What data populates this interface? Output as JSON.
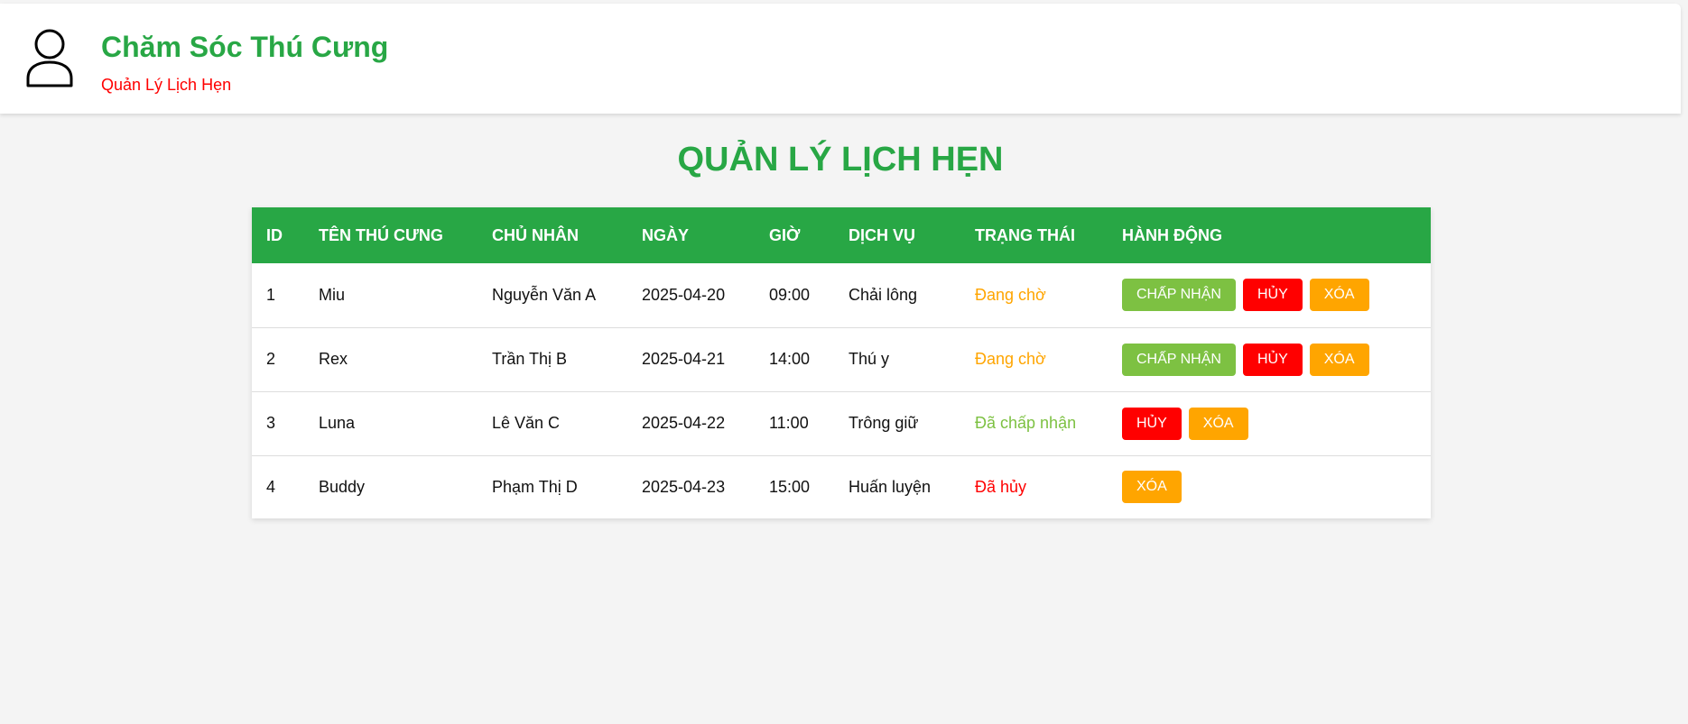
{
  "header": {
    "logo_icon": "user-icon",
    "title": "Chăm Sóc Thú Cưng",
    "subtitle": "Quản Lý Lịch Hẹn"
  },
  "page": {
    "title": "QUẢN LÝ LỊCH HẸN"
  },
  "colors": {
    "brand_green": "#28a745",
    "subtitle_red": "#ff0000",
    "accept_green": "#7dc142",
    "cancel_red": "#ff0000",
    "delete_orange": "#ffa500",
    "pending_orange": "#ffa500"
  },
  "table": {
    "columns": [
      "ID",
      "TÊN THÚ CƯNG",
      "CHỦ NHÂN",
      "NGÀY",
      "GIỜ",
      "DỊCH VỤ",
      "TRẠNG THÁI",
      "HÀNH ĐỘNG"
    ],
    "rows": [
      {
        "id": "1",
        "pet": "Miu",
        "owner": "Nguyễn Văn A",
        "date": "2025-04-20",
        "time": "09:00",
        "service": "Chải lông",
        "status": "Đang chờ",
        "accept": "CHẤP NHẬN",
        "cancel": "HỦY",
        "delete": "XÓA"
      },
      {
        "id": "2",
        "pet": "Rex",
        "owner": "Trần Thị B",
        "date": "2025-04-21",
        "time": "14:00",
        "service": "Thú y",
        "status": "Đang chờ",
        "accept": "CHẤP NHẬN",
        "cancel": "HỦY",
        "delete": "XÓA"
      },
      {
        "id": "3",
        "pet": "Luna",
        "owner": "Lê Văn C",
        "date": "2025-04-22",
        "time": "11:00",
        "service": "Trông giữ",
        "status": "Đã chấp nhận",
        "cancel": "HỦY",
        "delete": "XÓA"
      },
      {
        "id": "4",
        "pet": "Buddy",
        "owner": "Phạm Thị D",
        "date": "2025-04-23",
        "time": "15:00",
        "service": "Huấn luyện",
        "status": "Đã hủy",
        "delete": "XÓA"
      }
    ]
  }
}
